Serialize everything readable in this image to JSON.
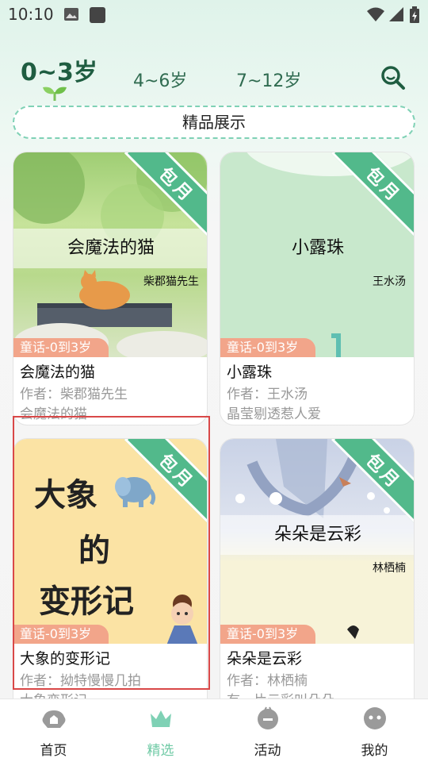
{
  "status_bar": {
    "time": "10:10"
  },
  "age_tabs": [
    {
      "label": "0~3岁",
      "active": true
    },
    {
      "label": "4~6岁",
      "active": false
    },
    {
      "label": "7~12岁",
      "active": false
    }
  ],
  "banner": {
    "label": "精品展示"
  },
  "ribbon_label": "包月",
  "books": [
    {
      "cover_title": "会魔法的猫",
      "cover_author": "柴郡猫先生",
      "genre": "童话-0到3岁",
      "title": "会魔法的猫",
      "author": "作者：柴郡猫先生",
      "desc": "会魔法的猫"
    },
    {
      "cover_title": "小露珠",
      "cover_author": "王水汤",
      "genre": "童话-0到3岁",
      "title": "小露珠",
      "author": "作者：王水汤",
      "desc": "晶莹剔透惹人爱"
    },
    {
      "cover_title_lines": [
        "大象",
        "的",
        "变形记"
      ],
      "genre": "童话-0到3岁",
      "title": "大象的变形记",
      "author": "作者：拗特慢慢几拍",
      "desc": "大象变形记"
    },
    {
      "cover_title": "朵朵是云彩",
      "cover_author": "林栖楠",
      "genre": "童话-0到3岁",
      "title": "朵朵是云彩",
      "author": "作者：林栖楠",
      "desc": "有一片云彩叫朵朵"
    }
  ],
  "bottom_nav": [
    {
      "label": "首页",
      "icon": "home-icon",
      "active": false
    },
    {
      "label": "精选",
      "icon": "crown-icon",
      "active": true
    },
    {
      "label": "活动",
      "icon": "activity-icon",
      "active": false
    },
    {
      "label": "我的",
      "icon": "profile-icon",
      "active": false
    }
  ],
  "colors": {
    "accent": "#52b98b",
    "genre_tag": "#f2a58a",
    "highlight": "#d94848"
  }
}
